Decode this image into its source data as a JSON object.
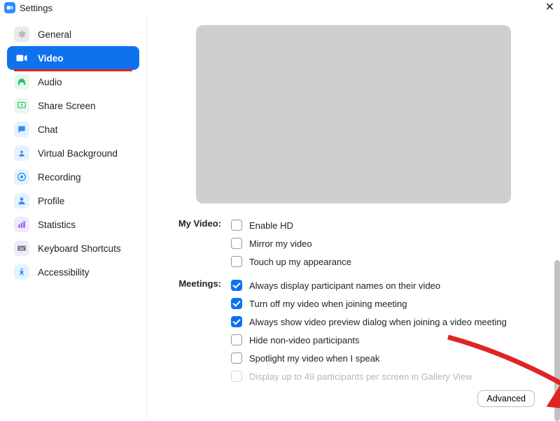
{
  "window": {
    "title": "Settings"
  },
  "sidebar": {
    "items": [
      {
        "key": "general",
        "label": "General"
      },
      {
        "key": "video",
        "label": "Video",
        "selected": true
      },
      {
        "key": "audio",
        "label": "Audio"
      },
      {
        "key": "share-screen",
        "label": "Share Screen"
      },
      {
        "key": "chat",
        "label": "Chat"
      },
      {
        "key": "virtual-background",
        "label": "Virtual Background"
      },
      {
        "key": "recording",
        "label": "Recording"
      },
      {
        "key": "profile",
        "label": "Profile"
      },
      {
        "key": "statistics",
        "label": "Statistics"
      },
      {
        "key": "keyboard-shortcuts",
        "label": "Keyboard Shortcuts"
      },
      {
        "key": "accessibility",
        "label": "Accessibility"
      }
    ]
  },
  "video": {
    "sections": {
      "my_video": {
        "heading": "My Video:",
        "options": [
          {
            "label": "Enable HD",
            "checked": false
          },
          {
            "label": "Mirror my video",
            "checked": false
          },
          {
            "label": "Touch up my appearance",
            "checked": false
          }
        ]
      },
      "meetings": {
        "heading": "Meetings:",
        "options": [
          {
            "label": "Always display participant names on their video",
            "checked": true
          },
          {
            "label": "Turn off my video when joining meeting",
            "checked": true
          },
          {
            "label": "Always show video preview dialog when joining a video meeting",
            "checked": true
          },
          {
            "label": "Hide non-video participants",
            "checked": false
          },
          {
            "label": "Spotlight my video when I speak",
            "checked": false
          },
          {
            "label": "Display up to 49 participants per screen in Gallery View",
            "checked": false,
            "disabled": true
          }
        ]
      }
    },
    "advanced_label": "Advanced"
  }
}
